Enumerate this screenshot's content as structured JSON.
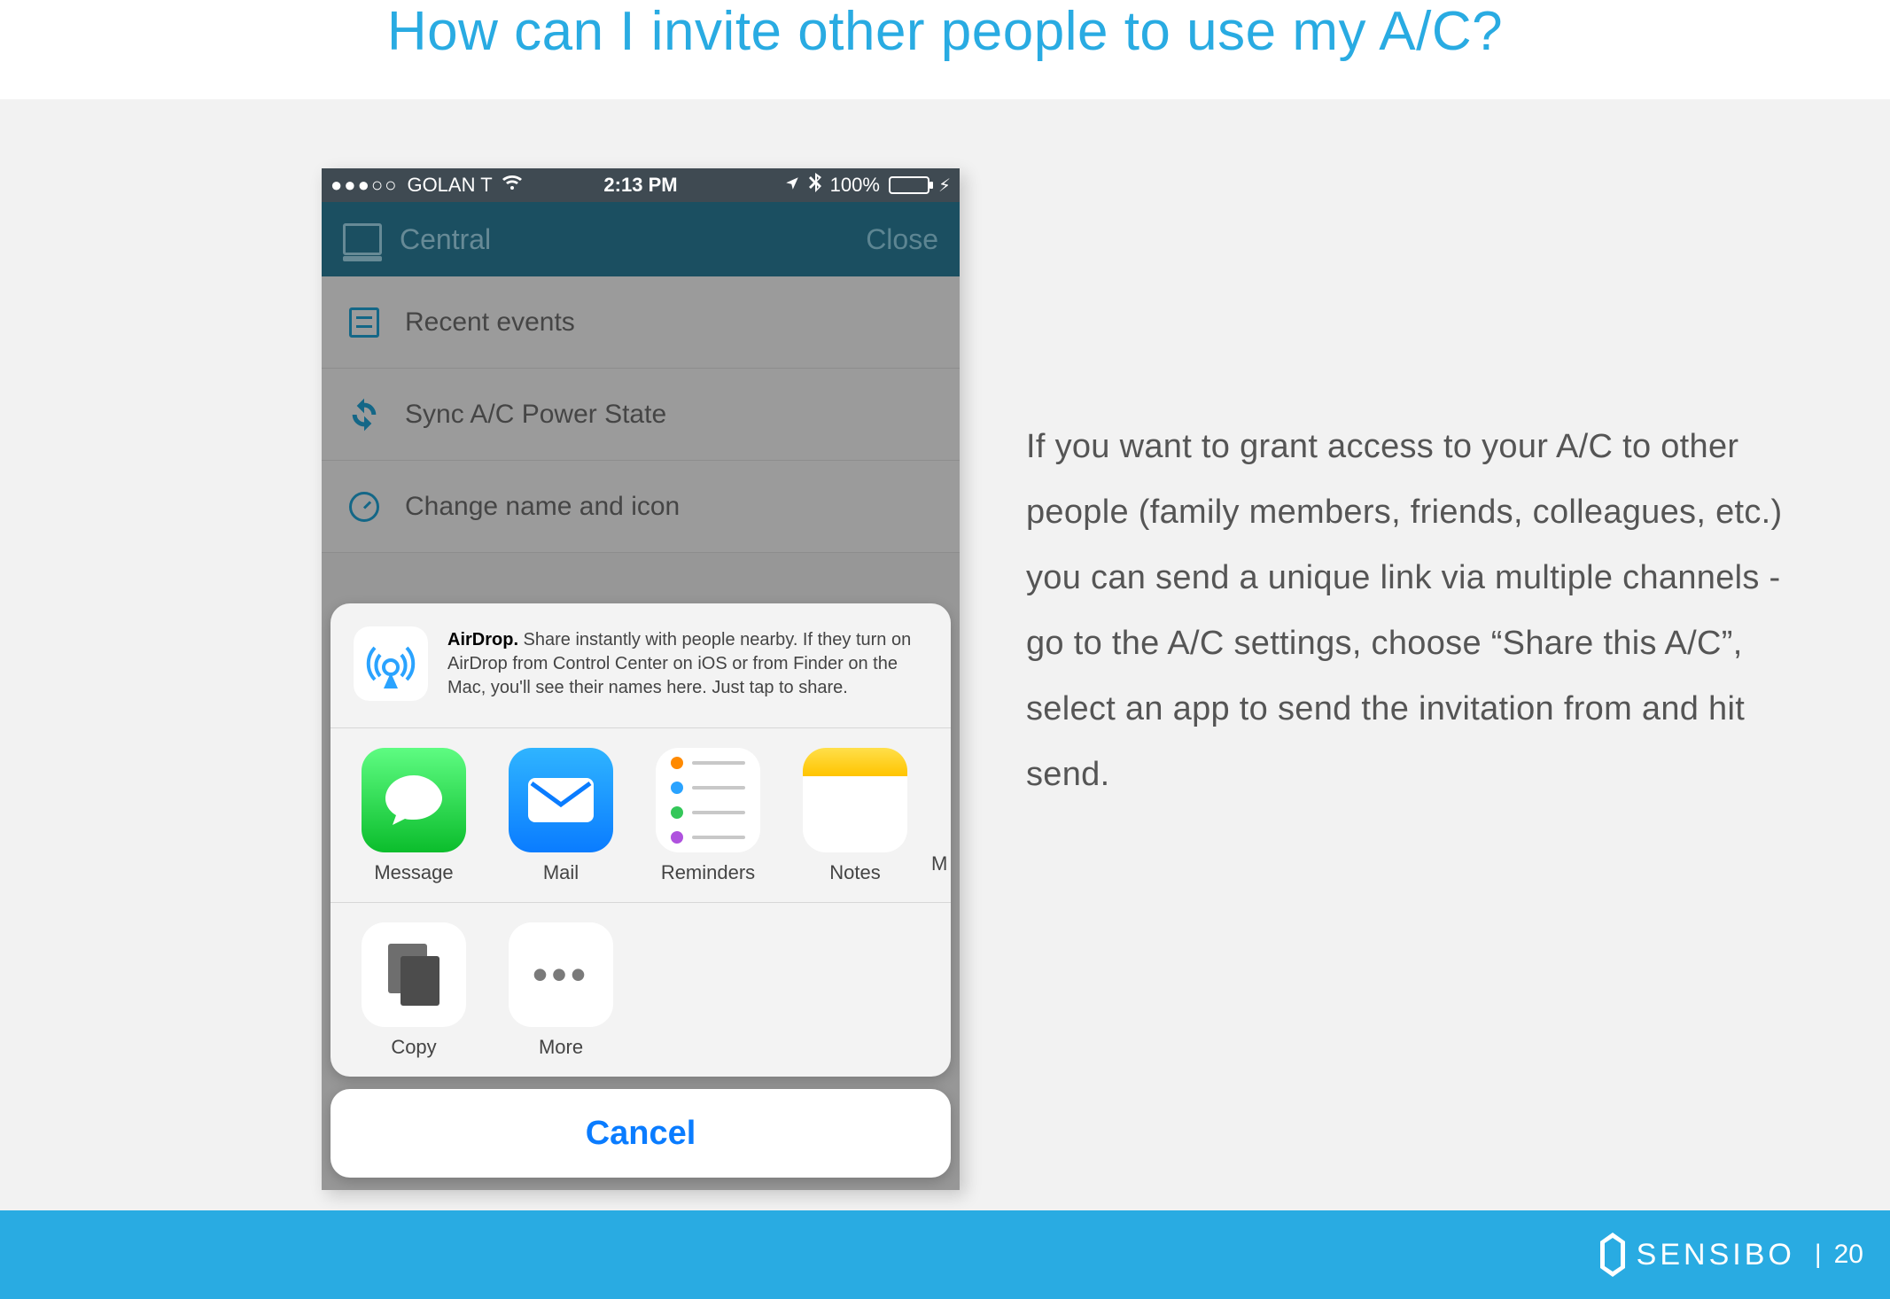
{
  "title": "How can I invite other people to use my A/C?",
  "description": "If you want to grant access to your A/C to other people (family members, friends, colleagues, etc.) you can send a unique link via multiple channels - go to the A/C settings, choose “Share this A/C”, select an app to send the invitation from and hit send.",
  "footer": {
    "brand": "SENSIBO",
    "page": "20"
  },
  "phone": {
    "status": {
      "carrier": "GOLAN T",
      "time": "2:13 PM",
      "battery_pct": "100%"
    },
    "header": {
      "title": "Central",
      "close": "Close"
    },
    "menu": {
      "items": [
        {
          "label": "Recent events"
        },
        {
          "label": "Sync A/C Power State"
        },
        {
          "label": "Change name and icon"
        }
      ]
    },
    "share": {
      "airdrop_bold": "AirDrop.",
      "airdrop_text": " Share instantly with people nearby. If they turn on AirDrop from Control Center on iOS or from Finder on the Mac, you'll see their names here. Just tap to share.",
      "apps": [
        {
          "label": "Message"
        },
        {
          "label": "Mail"
        },
        {
          "label": "Reminders"
        },
        {
          "label": "Notes"
        }
      ],
      "next_peek": "M",
      "actions": [
        {
          "label": "Copy"
        },
        {
          "label": "More"
        }
      ],
      "cancel": "Cancel"
    }
  }
}
